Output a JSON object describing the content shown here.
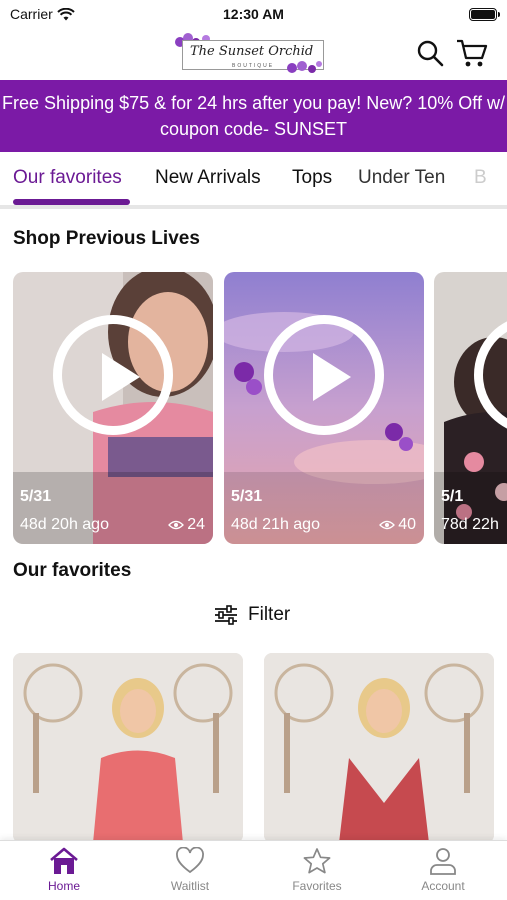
{
  "status_bar": {
    "carrier": "Carrier",
    "time": "12:30 AM"
  },
  "header": {
    "logo_text": "The Sunset Orchid",
    "logo_sub": "BOUTIQUE",
    "search_icon": "search-icon",
    "cart_icon": "cart-icon"
  },
  "banner": {
    "text": "Free Shipping $75 & for 24 hrs after you pay! New? 10% Off w/ coupon code- SUNSET",
    "background": "#7b1aa6"
  },
  "tabs": [
    {
      "label": "Our favorites",
      "active": true
    },
    {
      "label": "New Arrivals",
      "active": false
    },
    {
      "label": "Tops",
      "active": false
    },
    {
      "label": "Under Ten",
      "active": false
    },
    {
      "label": "B",
      "active": false
    }
  ],
  "shop_previous_lives": {
    "title": "Shop Previous Lives",
    "items": [
      {
        "date": "5/31",
        "ago": "48d 20h ago",
        "views": "24"
      },
      {
        "date": "5/31",
        "ago": "48d 21h ago",
        "views": "40"
      },
      {
        "date": "5/1",
        "ago": "78d 22h",
        "views": ""
      }
    ]
  },
  "favorites": {
    "title": "Our favorites",
    "filter_label": "Filter"
  },
  "bottom_nav": [
    {
      "label": "Home",
      "icon": "home-icon",
      "active": true
    },
    {
      "label": "Waitlist",
      "icon": "heart-icon",
      "active": false
    },
    {
      "label": "Favorites",
      "icon": "star-icon",
      "active": false
    },
    {
      "label": "Account",
      "icon": "person-icon",
      "active": false
    }
  ],
  "colors": {
    "accent": "#6b1a94",
    "banner": "#7b1aa6"
  }
}
